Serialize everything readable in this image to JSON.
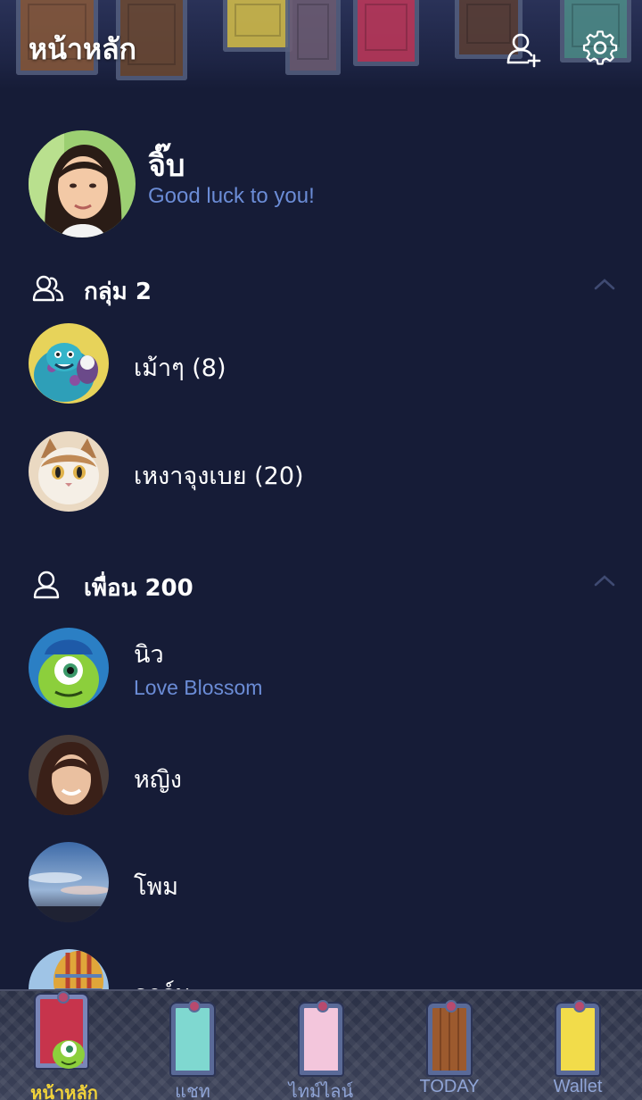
{
  "header": {
    "title": "หน้าหลัก",
    "add_friend_icon": "add-friend-icon",
    "settings_icon": "gear-icon"
  },
  "profile": {
    "name": "จิ๊บ",
    "status": "Good luck to you!"
  },
  "groups_section": {
    "title": "กลุ่ม 2",
    "icon": "group-icon",
    "items": [
      {
        "name": "เม้าๆ (8)"
      },
      {
        "name": "เหงาจุงเบย (20)"
      }
    ]
  },
  "friends_section": {
    "title": "เพื่อน 200",
    "icon": "person-icon",
    "items": [
      {
        "name": "นิว",
        "status": "Love Blossom"
      },
      {
        "name": "หญิง",
        "status": ""
      },
      {
        "name": "โพม",
        "status": ""
      },
      {
        "name": "อาร์ม.",
        "status": ""
      }
    ]
  },
  "tabbar": {
    "tabs": [
      {
        "label": "หน้าหลัก",
        "active": true
      },
      {
        "label": "แชท",
        "active": false
      },
      {
        "label": "ไทม์ไลน์",
        "active": false
      },
      {
        "label": "TODAY",
        "active": false
      },
      {
        "label": "Wallet",
        "active": false
      }
    ]
  },
  "colors": {
    "background": "#161c37",
    "status_text": "#6b8cd6",
    "active_tab": "#f0d23a",
    "inactive_tab": "#8fa4d6"
  }
}
